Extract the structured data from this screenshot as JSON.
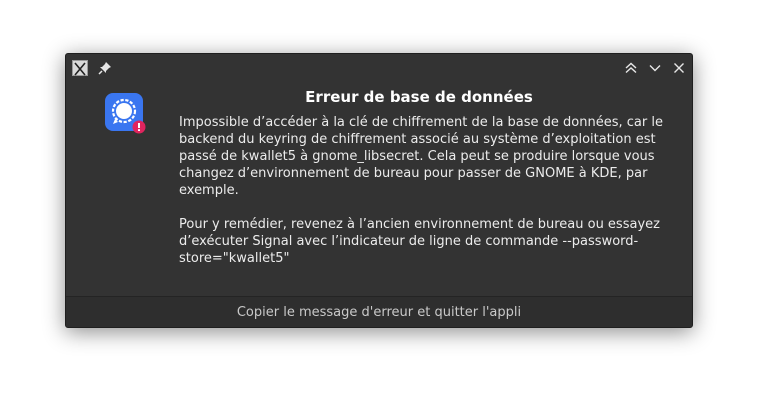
{
  "dialog": {
    "title": "Erreur de base de données",
    "paragraphs": [
      "Impossible d’accéder à la clé de chiffrement de la base de données, car le backend du keyring de chiffrement associé au système d’exploitation est passé de kwallet5 à gnome_libsecret. Cela peut se produire lorsque vous changez d’environnement de bureau pour passer de GNOME à KDE, par exemple.",
      "Pour y remédier, revenez à l’ancien environnement de bureau ou essayez d’exécuter Signal avec l’indicateur de ligne de commande --password-store=\"kwallet5\""
    ],
    "action_label": "Copier le message d'erreur et quitter l'appli"
  },
  "icons": {
    "app": "x-app-icon",
    "pin": "pin-icon",
    "maximize": "chevron-up-double-icon",
    "minimize": "chevron-down-icon",
    "close": "close-icon",
    "app_logo": "signal-logo-icon",
    "error_badge": "error-badge-icon"
  },
  "colors": {
    "window_bg": "#333333",
    "signal_blue": "#3a76f0",
    "error_red": "#e0245e"
  }
}
